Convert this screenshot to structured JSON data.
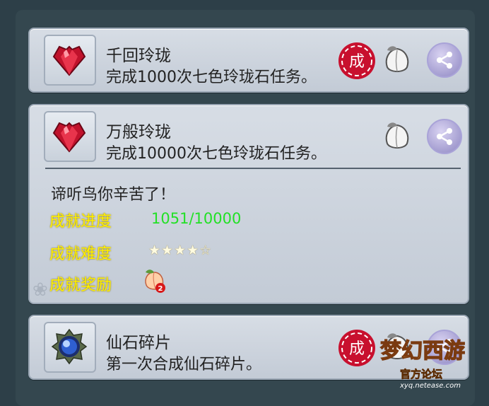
{
  "achievements": [
    {
      "title": "千回玲珑",
      "description": "完成1000次七色玲珑石任务。",
      "icon": "red-gem-icon",
      "completed_stamp": "成"
    },
    {
      "title": "万般玲珑",
      "description": "完成10000次七色玲珑石任务。",
      "icon": "red-gem-icon",
      "details": {
        "message": "谛听鸟你辛苦了！",
        "progress_label": "成就进度",
        "progress_value": "1051/10000",
        "difficulty_label": "成就难度",
        "difficulty_stars": "★★★★☆",
        "difficulty_rating": 4,
        "difficulty_max": 5,
        "reward_label": "成就奖励",
        "reward_icon": "peach-icon",
        "reward_count": "2"
      }
    },
    {
      "title": "仙石碎片",
      "description": "第一次合成仙石碎片。",
      "icon": "blue-orb-icon",
      "completed_stamp": "成"
    }
  ],
  "colors": {
    "label_yellow": "#ffef00",
    "progress_green": "#22e026",
    "stamp_red": "#c8102e"
  },
  "watermark": {
    "logo": "梦幻西游",
    "subtitle": "官方论坛",
    "url": "xyq.netease.com"
  }
}
